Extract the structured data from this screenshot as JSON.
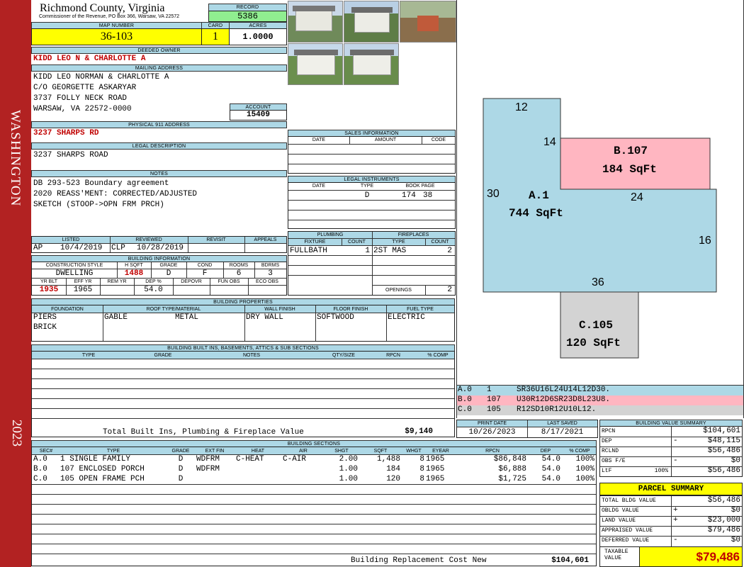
{
  "side": {
    "county": "WASHINGTON",
    "year": "2023"
  },
  "header": {
    "title": "Richmond County, Virginia",
    "subtitle": "Commissioner of the Revenue, PO Box 366, Warsaw, VA 22572",
    "record_label": "RECORD",
    "record": "5386",
    "map_label": "MAP NUMBER",
    "map": "36-103",
    "card_label": "CARD",
    "card": "1",
    "acres_label": "ACRES",
    "acres": "1.0000"
  },
  "owner": {
    "label": "DEEDED OWNER",
    "name": "KIDD LEO N & CHARLOTTE A"
  },
  "mailing": {
    "label": "MAILING ADDRESS",
    "lines": [
      "KIDD LEO NORMAN & CHARLOTTE A",
      "C/O GEORGETTE ASKARYAR",
      "3737 FOLLY NECK ROAD",
      "WARSAW, VA 22572-0000"
    ]
  },
  "account": {
    "label": "ACCOUNT",
    "value": "15409"
  },
  "physical": {
    "label": "PHYSICAL 911 ADDRESS",
    "value": "3237 SHARPS RD"
  },
  "legal": {
    "label": "LEGAL DESCRIPTION",
    "value": "3237 SHARPS ROAD"
  },
  "notes": {
    "label": "NOTES",
    "lines": [
      "DB 293-523 Boundary agreement",
      "2020 REASS'MENT: CORRECTED/ADJUSTED",
      "SKETCH (STOOP->OPN FRM PRCH)"
    ]
  },
  "sales": {
    "label": "SALES INFORMATION",
    "cols": [
      "DATE",
      "AMOUNT",
      "CODE"
    ]
  },
  "legal_instr": {
    "label": "LEGAL INSTRUMENTS",
    "cols": [
      "DATE",
      "TYPE",
      "BOOK PAGE"
    ],
    "row": {
      "type": "D",
      "book": "174",
      "page": "38"
    }
  },
  "review": {
    "cols": [
      "LISTED",
      "REVIEWED",
      "REVISIT",
      "APPEALS"
    ],
    "listed_by": "AP",
    "listed_date": "10/4/2019",
    "reviewed_by": "CLP",
    "reviewed_date": "10/28/2019"
  },
  "plumbing": {
    "label": "PLUMBING",
    "cols": [
      "FIXTURE",
      "COUNT"
    ],
    "fixture": "FULLBATH",
    "count": "1"
  },
  "fireplaces": {
    "label": "FIREPLACES",
    "cols": [
      "TYPE",
      "COUNT"
    ],
    "type": "2ST MAS",
    "count": "2",
    "openings_label": "OPENINGS",
    "openings": "2"
  },
  "building_info": {
    "label": "BUILDING INFORMATION",
    "cols1": [
      "CONSTRUCTION STYLE",
      "H SQFT",
      "GRADE",
      "COND",
      "ROOMS",
      "BDRMS"
    ],
    "style": "DWELLING",
    "hsqft": "1488",
    "grade": "D",
    "cond": "F",
    "rooms": "6",
    "bdrms": "3",
    "cols2": [
      "YR BLT",
      "EFF YR",
      "REM YR",
      "DEP %",
      "DEPOVR",
      "FUN OBS",
      "ECO OBS"
    ],
    "yrblt": "1935",
    "effyr": "1965",
    "dep": "54.0"
  },
  "props": {
    "label": "BUILDING PROPERTIES",
    "cols": [
      "FOUNDATION",
      "ROOF TYPE/MATERIAL",
      "WALL FINISH",
      "FLOOR FINISH",
      "FUEL TYPE"
    ],
    "foundation1": "PIERS",
    "foundation2": "BRICK",
    "roof_type": "GABLE",
    "roof_mat": "METAL",
    "wall": "DRY WALL",
    "floor": "SOFTWOOD",
    "fuel": "ELECTRIC"
  },
  "builtins": {
    "label": "BUILDING BUILT INS, BASEMENTS, ATTICS & SUB SECTIONS",
    "cols": [
      "TYPE",
      "GRADE",
      "NOTES",
      "QTY/SIZE",
      "RPCN",
      "% COMP"
    ],
    "total_label": "Total Built Ins, Plumbing & Fireplace Value",
    "total": "$9,140"
  },
  "print": {
    "cols": [
      "PRINT DATE",
      "LAST SAVED"
    ],
    "print_date": "10/26/2023",
    "last_saved": "8/17/2021"
  },
  "sections": {
    "label": "BUILDING SECTIONS",
    "cols": [
      "SEC#",
      "TYPE",
      "GRADE",
      "EXT FIN",
      "HEAT",
      "AIR",
      "SHGT",
      "SQFT",
      "WHGT",
      "EYEAR",
      "RPCN",
      "DEP",
      "% COMP"
    ],
    "rows": [
      {
        "sec": "A.0",
        "type": "1 SINGLE FAMILY",
        "grade": "D",
        "ext": "WDFRM",
        "heat": "C-HEAT",
        "air": "C-AIR",
        "shgt": "2.00",
        "sqft": "1,488",
        "whgt": "8",
        "eyear": "1965",
        "rpcn": "$86,848",
        "dep": "54.0",
        "comp": "100%"
      },
      {
        "sec": "B.0",
        "type": "107 ENCLOSED PORCH",
        "grade": "D",
        "ext": "WDFRM",
        "heat": "",
        "air": "",
        "shgt": "1.00",
        "sqft": "184",
        "whgt": "8",
        "eyear": "1965",
        "rpcn": "$6,888",
        "dep": "54.0",
        "comp": "100%"
      },
      {
        "sec": "C.0",
        "type": "105 OPEN FRAME PCH",
        "grade": "D",
        "ext": "",
        "heat": "",
        "air": "",
        "shgt": "1.00",
        "sqft": "120",
        "whgt": "8",
        "eyear": "1965",
        "rpcn": "$1,725",
        "dep": "54.0",
        "comp": "100%"
      }
    ],
    "replacement_label": "Building Replacement Cost New",
    "replacement": "$104,601"
  },
  "sketch": {
    "dims": [
      "12",
      "14",
      "30",
      "24",
      "16",
      "36"
    ],
    "a_label": "A.1",
    "a_area": "744 SqFt",
    "b_label": "B.107",
    "b_area": "184 SqFt",
    "c_label": "C.105",
    "c_area": "120 SqFt",
    "colors": {
      "a": "#add8e6",
      "b": "#ffb6c1",
      "c": "#d3d3d3"
    },
    "legend": [
      {
        "sec": "A.0",
        "code": "1",
        "path": "SR36U16L24U14L12D30."
      },
      {
        "sec": "B.0",
        "code": "107",
        "path": "U30R12D6SR23D8L23U8."
      },
      {
        "sec": "C.0",
        "code": "105",
        "path": "R12SD10R12U10L12."
      }
    ]
  },
  "bvs": {
    "label": "BUILDING VALUE SUMMARY",
    "rows": [
      {
        "k": "RPCN",
        "op": "",
        "pct": "",
        "v": "$104,601"
      },
      {
        "k": "DEP",
        "op": "-",
        "pct": "",
        "v": "$48,115"
      },
      {
        "k": "RCLND",
        "op": "",
        "pct": "",
        "v": "$56,486"
      },
      {
        "k": "OBS F/E",
        "op": "-",
        "pct": "",
        "v": "$0"
      },
      {
        "k": "LtF",
        "op": "",
        "pct": "100%",
        "v": "$56,486"
      }
    ]
  },
  "parcel": {
    "label": "PARCEL SUMMARY",
    "rows": [
      {
        "k": "TOTAL BLDG VALUE",
        "op": "",
        "v": "$56,486"
      },
      {
        "k": "OBLDG VALUE",
        "op": "+",
        "v": "$0"
      },
      {
        "k": "LAND VALUE",
        "op": "+",
        "v": "$23,000"
      },
      {
        "k": "APPRAISED VALUE",
        "op": "",
        "v": "$79,486"
      },
      {
        "k": "DEFERRED VALUE",
        "op": "-",
        "v": "$0"
      }
    ],
    "taxable_label": "TAXABLE VALUE",
    "taxable": "$79,486"
  }
}
